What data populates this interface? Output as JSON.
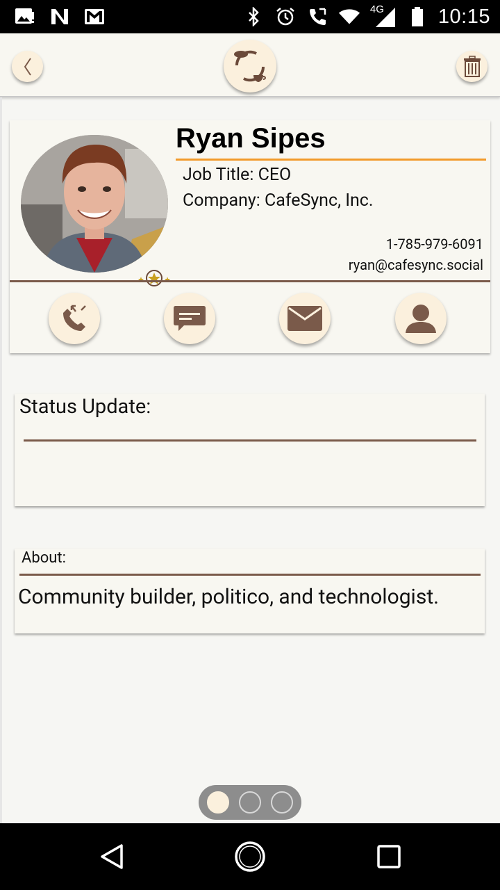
{
  "status_bar": {
    "time": "10:15",
    "network": "4G",
    "icons": [
      "gallery-notification-icon",
      "n-notification-icon",
      "gmail-icon",
      "bluetooth-icon",
      "alarm-icon",
      "call-icon",
      "wifi-icon",
      "cell-signal-icon",
      "battery-icon"
    ]
  },
  "top_bar": {
    "back_icon": "chevron-left-icon",
    "logo_icon": "cafesync-logo-icon",
    "trash_icon": "trash-icon"
  },
  "profile": {
    "name": "Ryan Sipes",
    "job_title": "Job Title: CEO",
    "company": "Company: CafeSync, Inc.",
    "phone": "1-785-979-6091",
    "email": "ryan@cafesync.social",
    "avatar": "profile-photo",
    "badge": "stars-badge-icon"
  },
  "actions": [
    {
      "name": "call",
      "icon": "phone-icon"
    },
    {
      "name": "message",
      "icon": "chat-bubble-icon"
    },
    {
      "name": "email",
      "icon": "envelope-icon"
    },
    {
      "name": "contact",
      "icon": "person-icon"
    }
  ],
  "status_update": {
    "label": "Status Update:",
    "text": ""
  },
  "about": {
    "label": "About:",
    "text": "Community builder, politico, and technologist."
  },
  "pager": {
    "pages": 3,
    "active": 1
  },
  "colors": {
    "accent_orange": "#f29a2a",
    "brown": "#7a5a4a",
    "button_cream": "#fbf0dd",
    "card_bg": "#f8f7f1"
  },
  "nav": [
    "back-triangle-icon",
    "home-circle-icon",
    "recents-square-icon"
  ]
}
